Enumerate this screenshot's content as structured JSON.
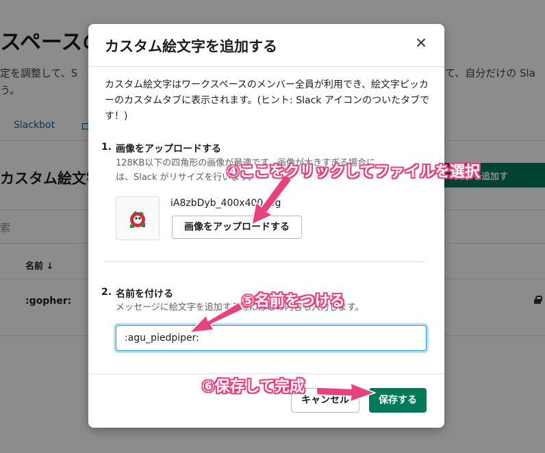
{
  "background": {
    "title": "スペースの",
    "desc_line1": "定を調整して、S",
    "desc_line1_right": "て、自分だけの Sla",
    "desc_line2": "う。",
    "tab_slackbot": "Slackbot",
    "tab_other": "ロ",
    "heading": "カスタム絵文字",
    "add_button": "文字を追加す",
    "search_placeholder": "索",
    "col_name": "名前 ↓",
    "row_name": ":gopher:"
  },
  "modal": {
    "title": "カスタム絵文字を追加する",
    "close_label": "✕",
    "intro": "カスタム絵文字はワークスペースのメンバー全員が利用でき、絵文字ピッカーのカスタムタブに表示されます。(ヒント: Slack アイコンのついたタブです！)",
    "step1": {
      "number": "1.",
      "title": "画像をアップロードする",
      "desc_line1": "128KB以下の四角形の画像が最適です。画像が大きすぎる場合に",
      "desc_line2": "は、Slack がリサイズを行います。",
      "file_name": "iA8zbDyb_400x400.jpg",
      "upload_button": "画像をアップロードする"
    },
    "step2": {
      "number": "2.",
      "title": "名前を付ける",
      "desc": "メッセージに絵文字を追加する際にはこの内容も入力します。",
      "input_value": ":agu_piedpiper:"
    },
    "footer": {
      "cancel": "キャンセル",
      "save": "保存する"
    }
  },
  "annotations": {
    "step4": "④ここをクリックしてファイルを選択",
    "step5": "⑤名前をつける",
    "step6": "⑥保存して完成"
  },
  "colors": {
    "accent_green": "#007a5a",
    "annotation_pink": "#e8417d",
    "focus_blue": "#1d9bd1"
  }
}
